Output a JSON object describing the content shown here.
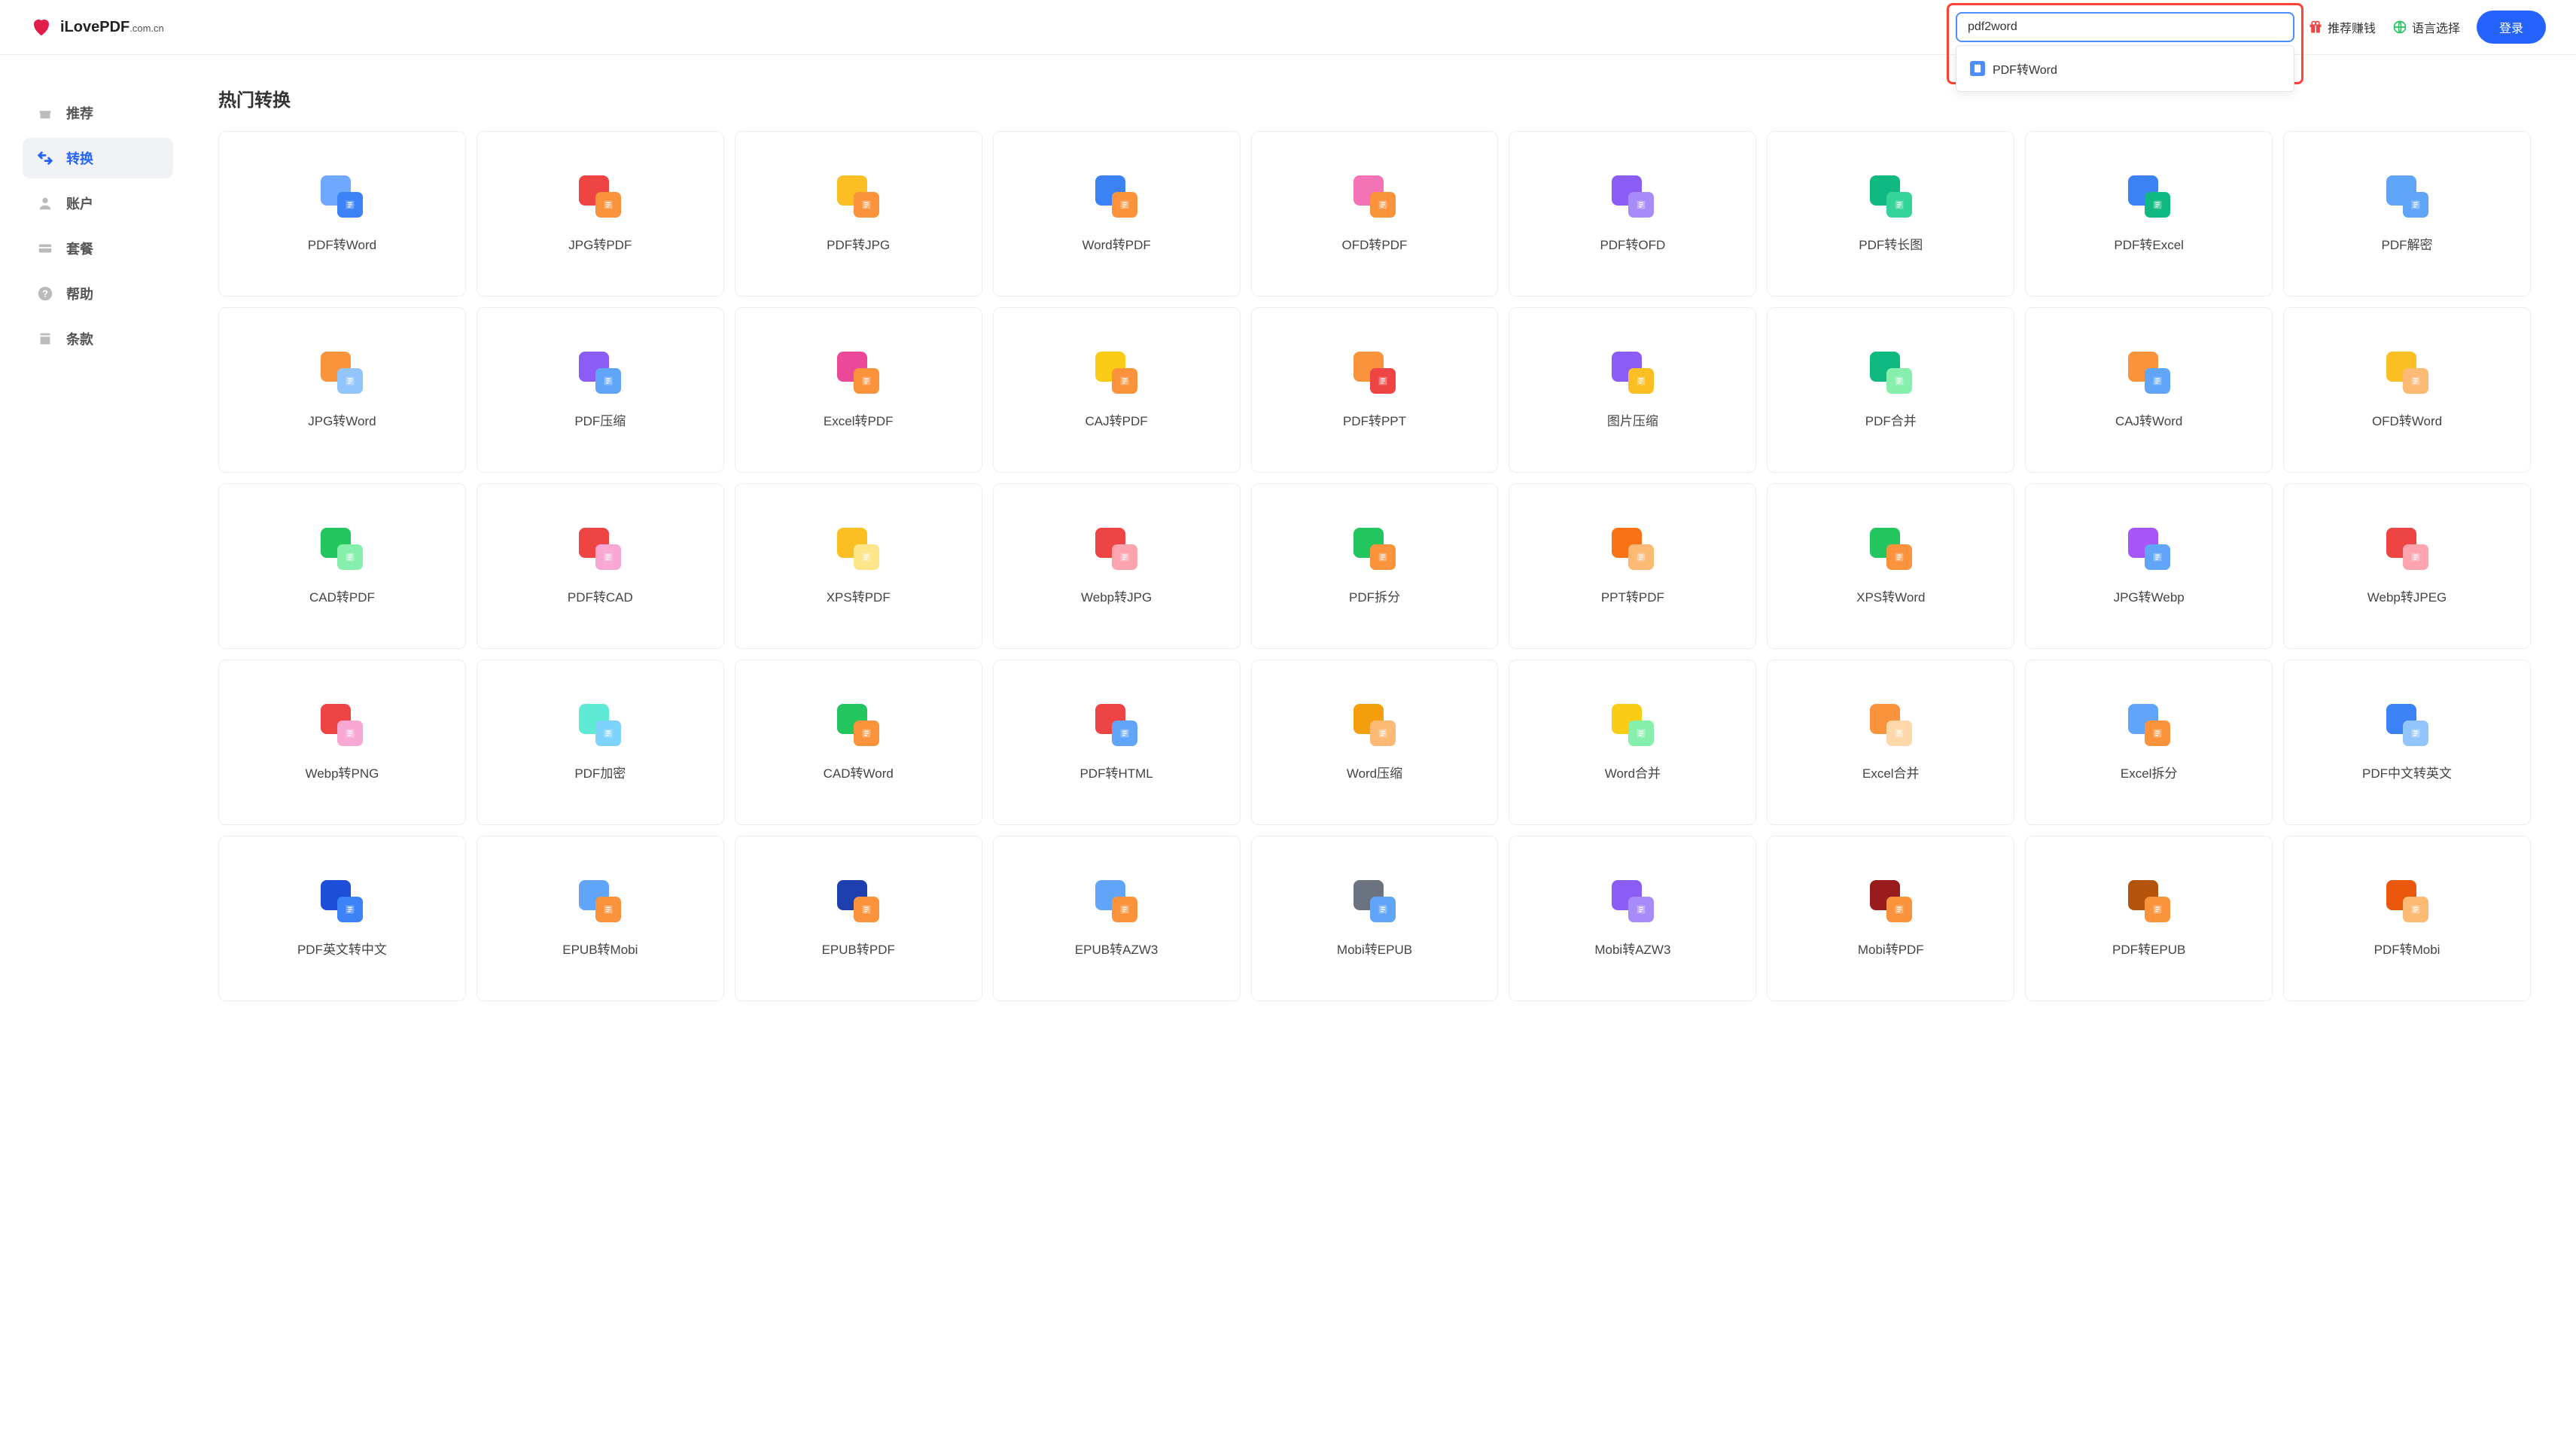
{
  "header": {
    "logo_main": "iLovePDF",
    "logo_suffix": ".com.cn",
    "search_value": "pdf2word",
    "search_suggestion": "PDF转Word",
    "recommend_money": "推荐赚钱",
    "language_select": "语言选择",
    "login": "登录"
  },
  "sidebar": {
    "items": [
      {
        "id": "recommend",
        "label": "推荐",
        "icon": "gift"
      },
      {
        "id": "convert",
        "label": "转换",
        "icon": "arrows",
        "active": true
      },
      {
        "id": "account",
        "label": "账户",
        "icon": "user"
      },
      {
        "id": "plan",
        "label": "套餐",
        "icon": "card"
      },
      {
        "id": "help",
        "label": "帮助",
        "icon": "question"
      },
      {
        "id": "terms",
        "label": "条款",
        "icon": "bookmark"
      }
    ]
  },
  "content": {
    "section_title": "热门转换",
    "cards": [
      {
        "label": "PDF转Word",
        "c1": "#6fa8ff",
        "c2": "#3b82f6"
      },
      {
        "label": "JPG转PDF",
        "c1": "#ef4444",
        "c2": "#fb923c"
      },
      {
        "label": "PDF转JPG",
        "c1": "#fbbf24",
        "c2": "#fb923c"
      },
      {
        "label": "Word转PDF",
        "c1": "#3b82f6",
        "c2": "#fb923c"
      },
      {
        "label": "OFD转PDF",
        "c1": "#f472b6",
        "c2": "#fb923c"
      },
      {
        "label": "PDF转OFD",
        "c1": "#8b5cf6",
        "c2": "#a78bfa"
      },
      {
        "label": "PDF转长图",
        "c1": "#10b981",
        "c2": "#34d399"
      },
      {
        "label": "PDF转Excel",
        "c1": "#3b82f6",
        "c2": "#10b981"
      },
      {
        "label": "PDF解密",
        "c1": "#60a5fa",
        "c2": "#60a5fa"
      },
      {
        "label": "JPG转Word",
        "c1": "#fb923c",
        "c2": "#93c5fd"
      },
      {
        "label": "PDF压缩",
        "c1": "#8b5cf6",
        "c2": "#60a5fa"
      },
      {
        "label": "Excel转PDF",
        "c1": "#ec4899",
        "c2": "#fb923c"
      },
      {
        "label": "CAJ转PDF",
        "c1": "#facc15",
        "c2": "#fb923c"
      },
      {
        "label": "PDF转PPT",
        "c1": "#fb923c",
        "c2": "#ef4444"
      },
      {
        "label": "图片压缩",
        "c1": "#8b5cf6",
        "c2": "#fbbf24"
      },
      {
        "label": "PDF合并",
        "c1": "#10b981",
        "c2": "#86efac"
      },
      {
        "label": "CAJ转Word",
        "c1": "#fb923c",
        "c2": "#60a5fa"
      },
      {
        "label": "OFD转Word",
        "c1": "#fbbf24",
        "c2": "#fdba74"
      },
      {
        "label": "CAD转PDF",
        "c1": "#22c55e",
        "c2": "#86efac"
      },
      {
        "label": "PDF转CAD",
        "c1": "#ef4444",
        "c2": "#f9a8d4"
      },
      {
        "label": "XPS转PDF",
        "c1": "#fbbf24",
        "c2": "#fde68a"
      },
      {
        "label": "Webp转JPG",
        "c1": "#ef4444",
        "c2": "#fda4af"
      },
      {
        "label": "PDF拆分",
        "c1": "#22c55e",
        "c2": "#fb923c"
      },
      {
        "label": "PPT转PDF",
        "c1": "#f97316",
        "c2": "#fdba74"
      },
      {
        "label": "XPS转Word",
        "c1": "#22c55e",
        "c2": "#fb923c"
      },
      {
        "label": "JPG转Webp",
        "c1": "#a855f7",
        "c2": "#60a5fa"
      },
      {
        "label": "Webp转JPEG",
        "c1": "#ef4444",
        "c2": "#fda4af"
      },
      {
        "label": "Webp转PNG",
        "c1": "#ef4444",
        "c2": "#f9a8d4"
      },
      {
        "label": "PDF加密",
        "c1": "#5eead4",
        "c2": "#7dd3fc"
      },
      {
        "label": "CAD转Word",
        "c1": "#22c55e",
        "c2": "#fb923c"
      },
      {
        "label": "PDF转HTML",
        "c1": "#ef4444",
        "c2": "#60a5fa"
      },
      {
        "label": "Word压缩",
        "c1": "#f59e0b",
        "c2": "#fdba74"
      },
      {
        "label": "Word合并",
        "c1": "#facc15",
        "c2": "#86efac"
      },
      {
        "label": "Excel合并",
        "c1": "#fb923c",
        "c2": "#fed7aa"
      },
      {
        "label": "Excel拆分",
        "c1": "#60a5fa",
        "c2": "#fb923c"
      },
      {
        "label": "PDF中文转英文",
        "c1": "#3b82f6",
        "c2": "#93c5fd"
      },
      {
        "label": "PDF英文转中文",
        "c1": "#1d4ed8",
        "c2": "#3b82f6"
      },
      {
        "label": "EPUB转Mobi",
        "c1": "#60a5fa",
        "c2": "#fb923c"
      },
      {
        "label": "EPUB转PDF",
        "c1": "#1e40af",
        "c2": "#fb923c"
      },
      {
        "label": "EPUB转AZW3",
        "c1": "#60a5fa",
        "c2": "#fb923c"
      },
      {
        "label": "Mobi转EPUB",
        "c1": "#6b7280",
        "c2": "#60a5fa"
      },
      {
        "label": "Mobi转AZW3",
        "c1": "#8b5cf6",
        "c2": "#a78bfa"
      },
      {
        "label": "Mobi转PDF",
        "c1": "#991b1b",
        "c2": "#fb923c"
      },
      {
        "label": "PDF转EPUB",
        "c1": "#b45309",
        "c2": "#fb923c"
      },
      {
        "label": "PDF转Mobi",
        "c1": "#ea580c",
        "c2": "#fdba74"
      }
    ]
  }
}
